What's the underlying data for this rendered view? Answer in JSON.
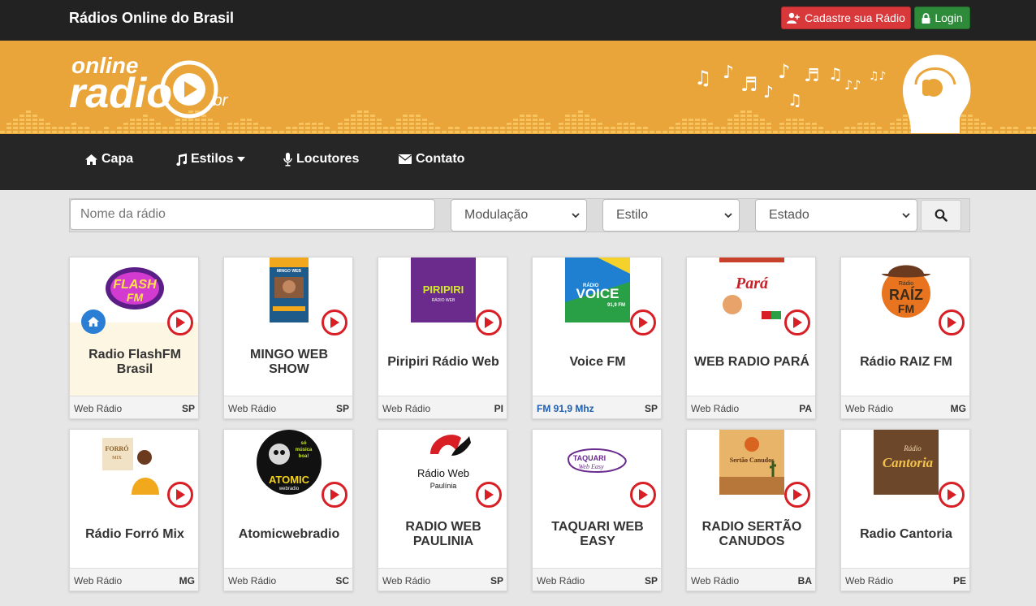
{
  "header": {
    "site_title": "Rádios Online do Brasil",
    "register_label": "Cadastre sua Rádio",
    "login_label": "Login",
    "register_color": "#d9383a",
    "login_color": "#2e8b3a"
  },
  "banner": {
    "logo_text_top": "online",
    "logo_text_main": "radio",
    "logo_suffix": ".br",
    "background_color": "#e9a53a"
  },
  "nav": {
    "items": [
      {
        "label": "Capa",
        "icon": "home-icon"
      },
      {
        "label": "Estilos",
        "icon": "music-icon"
      },
      {
        "label": "Locutores",
        "icon": "microphone-icon"
      },
      {
        "label": "Contato",
        "icon": "envelope-icon"
      }
    ]
  },
  "search": {
    "name_placeholder": "Nome da rádio",
    "modulation_value": "Modulação",
    "style_value": "Estilo",
    "state_value": "Estado"
  },
  "radios": [
    {
      "name": "Radio FlashFM Brasil",
      "type": "Web Rádio",
      "state": "SP"
    },
    {
      "name": "MINGO WEB SHOW",
      "type": "Web Rádio",
      "state": "SP"
    },
    {
      "name": "Piripiri Rádio Web",
      "type": "Web Rádio",
      "state": "PI"
    },
    {
      "name": "Voice FM",
      "type": "FM 91,9 Mhz",
      "state": "SP"
    },
    {
      "name": "WEB RADIO PARÁ",
      "type": "Web Rádio",
      "state": "PA"
    },
    {
      "name": "Rádio RAIZ FM",
      "type": "Web Rádio",
      "state": "MG"
    },
    {
      "name": "Rádio Forró Mix",
      "type": "Web Rádio",
      "state": "MG"
    },
    {
      "name": "Atomicwebradio",
      "type": "Web Rádio",
      "state": "SC"
    },
    {
      "name": "RADIO WEB PAULINIA",
      "type": "Web Rádio",
      "state": "SP"
    },
    {
      "name": "TAQUARI WEB EASY",
      "type": "Web Rádio",
      "state": "SP"
    },
    {
      "name": "RADIO SERTÃO CANUDOS",
      "type": "Web Rádio",
      "state": "BA"
    },
    {
      "name": "Radio Cantoria",
      "type": "Web Rádio",
      "state": "PE"
    }
  ],
  "logos": {
    "flash": {
      "line1": "FLASH",
      "line2": "FM"
    },
    "mingo": "MINGO WEB",
    "piripiri": {
      "line1": "PIRIPIRI",
      "line2": "RÁDIO WEB"
    },
    "voice": {
      "line1": "RÁDIO",
      "line2": "VOICE",
      "line3": "91,9 FM"
    },
    "para": "Pará",
    "raiz": {
      "line1": "Rádio",
      "line2": "RAÍZ",
      "line3": "FM"
    },
    "forro": {
      "line1": "FORRÓ",
      "line2": "MIX"
    },
    "atomic": {
      "line1": "só",
      "line2": "música",
      "line3": "boa!",
      "line4": "ATOMIC",
      "line5": "webradio"
    },
    "paulinia": {
      "line1": "Rádio Web",
      "line2": "Paulínia"
    },
    "taquari": {
      "line1": "TAQUARI",
      "line2": "Web Easy"
    },
    "sertao": "Sertão Canudos",
    "cantoria": {
      "line1": "Rádio",
      "line2": "Cantoria"
    }
  }
}
